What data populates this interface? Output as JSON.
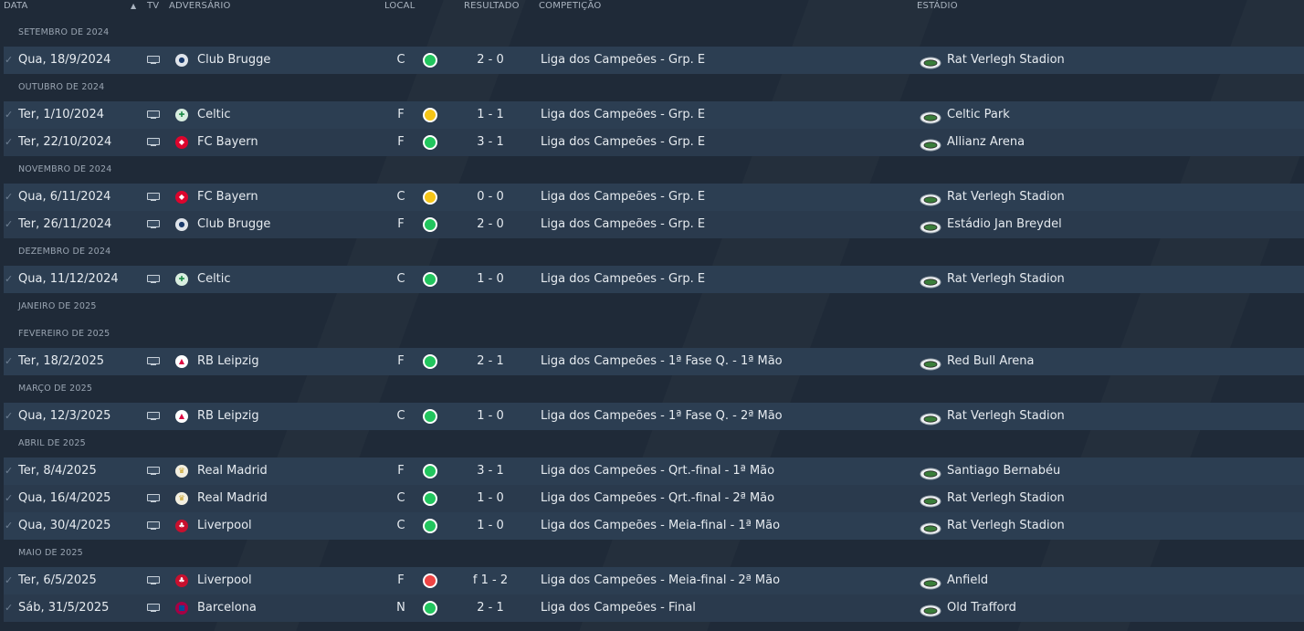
{
  "columns": {
    "data": "DATA",
    "tv": "TV",
    "adversario": "ADVERSÁRIO",
    "local": "LOCAL",
    "resultado": "RESULTADO",
    "competicao": "COMPETIÇÃO",
    "estadio": "ESTÁDIO",
    "sort_indicator": "▲"
  },
  "colors": {
    "win": "#22c55e",
    "draw": "#f5c518",
    "loss": "#ef4444"
  },
  "months": [
    {
      "label": "SETEMBRO DE 2024",
      "matches": [
        {
          "date": "Qua, 18/9/2024",
          "opponent": "Club Brugge",
          "crest": "brugge",
          "venue": "C",
          "result": "win",
          "score": "2 - 0",
          "competition": "Liga dos Campeões - Grp. E",
          "stadium": "Rat Verlegh Stadion"
        }
      ]
    },
    {
      "label": "OUTUBRO DE 2024",
      "matches": [
        {
          "date": "Ter, 1/10/2024",
          "opponent": "Celtic",
          "crest": "celtic",
          "venue": "F",
          "result": "draw",
          "score": "1 - 1",
          "competition": "Liga dos Campeões - Grp. E",
          "stadium": "Celtic Park"
        },
        {
          "date": "Ter, 22/10/2024",
          "opponent": "FC Bayern",
          "crest": "bayern",
          "venue": "F",
          "result": "win",
          "score": "3 - 1",
          "competition": "Liga dos Campeões - Grp. E",
          "stadium": "Allianz Arena"
        }
      ]
    },
    {
      "label": "NOVEMBRO DE 2024",
      "matches": [
        {
          "date": "Qua, 6/11/2024",
          "opponent": "FC Bayern",
          "crest": "bayern",
          "venue": "C",
          "result": "draw",
          "score": "0 - 0",
          "competition": "Liga dos Campeões - Grp. E",
          "stadium": "Rat Verlegh Stadion"
        },
        {
          "date": "Ter, 26/11/2024",
          "opponent": "Club Brugge",
          "crest": "brugge",
          "venue": "F",
          "result": "win",
          "score": "2 - 0",
          "competition": "Liga dos Campeões - Grp. E",
          "stadium": "Estádio Jan Breydel"
        }
      ]
    },
    {
      "label": "DEZEMBRO DE 2024",
      "matches": [
        {
          "date": "Qua, 11/12/2024",
          "opponent": "Celtic",
          "crest": "celtic",
          "venue": "C",
          "result": "win",
          "score": "1 - 0",
          "competition": "Liga dos Campeões - Grp. E",
          "stadium": "Rat Verlegh Stadion"
        }
      ]
    },
    {
      "label": "JANEIRO DE 2025",
      "matches": []
    },
    {
      "label": "FEVEREIRO DE 2025",
      "matches": [
        {
          "date": "Ter, 18/2/2025",
          "opponent": "RB Leipzig",
          "crest": "leipzig",
          "venue": "F",
          "result": "win",
          "score": "2 - 1",
          "competition": "Liga dos Campeões - 1ª Fase Q. - 1ª Mão",
          "stadium": "Red Bull Arena"
        }
      ]
    },
    {
      "label": "MARÇO DE 2025",
      "matches": [
        {
          "date": "Qua, 12/3/2025",
          "opponent": "RB Leipzig",
          "crest": "leipzig",
          "venue": "C",
          "result": "win",
          "score": "1 - 0",
          "competition": "Liga dos Campeões - 1ª Fase Q. - 2ª Mão",
          "stadium": "Rat Verlegh Stadion"
        }
      ]
    },
    {
      "label": "ABRIL DE 2025",
      "matches": [
        {
          "date": "Ter, 8/4/2025",
          "opponent": "Real Madrid",
          "crest": "realmadrid",
          "venue": "F",
          "result": "win",
          "score": "3 - 1",
          "competition": "Liga dos Campeões - Qrt.-final - 1ª Mão",
          "stadium": "Santiago Bernabéu"
        },
        {
          "date": "Qua, 16/4/2025",
          "opponent": "Real Madrid",
          "crest": "realmadrid",
          "venue": "C",
          "result": "win",
          "score": "1 - 0",
          "competition": "Liga dos Campeões - Qrt.-final - 2ª Mão",
          "stadium": "Rat Verlegh Stadion"
        },
        {
          "date": "Qua, 30/4/2025",
          "opponent": "Liverpool",
          "crest": "liverpool",
          "venue": "C",
          "result": "win",
          "score": "1 - 0",
          "competition": "Liga dos Campeões - Meia-final - 1ª Mão",
          "stadium": "Rat Verlegh Stadion"
        }
      ]
    },
    {
      "label": "MAIO DE 2025",
      "matches": [
        {
          "date": "Ter, 6/5/2025",
          "opponent": "Liverpool",
          "crest": "liverpool",
          "venue": "F",
          "result": "loss",
          "score": "f 1 - 2",
          "competition": "Liga dos Campeões - Meia-final - 2ª Mão",
          "stadium": "Anfield"
        },
        {
          "date": "Sáb, 31/5/2025",
          "opponent": "Barcelona",
          "crest": "barcelona",
          "venue": "N",
          "result": "win",
          "score": "2 - 1",
          "competition": "Liga dos Campeões - Final",
          "stadium": "Old Trafford"
        }
      ]
    }
  ]
}
